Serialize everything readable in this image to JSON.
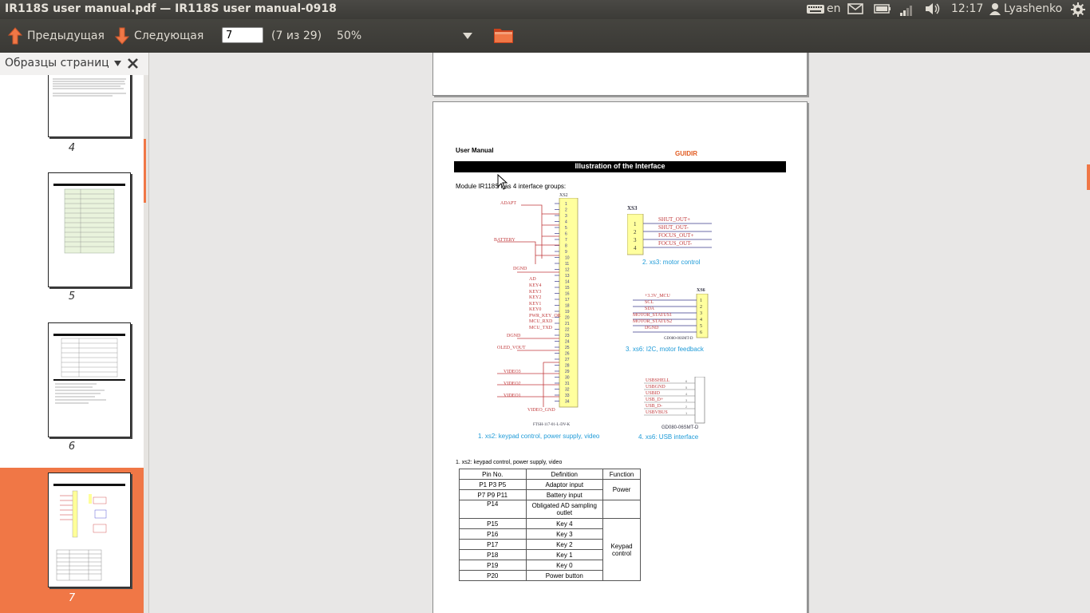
{
  "window_title": "IR118S user manual.pdf — IR118S user manual-0918",
  "panel": {
    "keyboard_layout": "en",
    "clock": "12:17",
    "user": "Lyashenko"
  },
  "toolbar": {
    "prev_label": "Предыдущая",
    "next_label": "Следующая",
    "page_value": "7",
    "page_count_label": "(7 из 29)",
    "zoom": "50%"
  },
  "sidebar": {
    "title": "Образцы страниц",
    "thumbnails": [
      {
        "label": "4"
      },
      {
        "label": "5"
      },
      {
        "label": "6"
      },
      {
        "label": "7",
        "selected": true
      }
    ]
  },
  "document": {
    "header_left": "User Manual",
    "logo": "GUIDIR",
    "section_title": "Illustration of the Interface",
    "intro": "Module IR118S has 4 interface groups:",
    "xs2": {
      "connector": "XS2",
      "left_labels": [
        "ADAPT",
        "BATTERY",
        "DGND",
        "AD",
        "KEY4",
        "KEY3",
        "KEY2",
        "KEY1",
        "KEY0",
        "PWR_KEY_OR",
        "MCU_RXD",
        "MCU_TXD",
        "DGND",
        "OLED_VOUT",
        "VIDEO3",
        "VIDEO2",
        "VIDEO1",
        "VIDEO_GND"
      ],
      "part": "FTSH-117-01-L-DV-K",
      "caption": "1. xs2: keypad control, power supply, video"
    },
    "xs3": {
      "connector": "XS3",
      "signals": [
        "SHUT_OUT+",
        "SHUT_OUT-",
        "FOCUS_OUT+",
        "FOCUS_OUT-"
      ],
      "caption": "2. xs3: motor control"
    },
    "xs6": {
      "connector": "XS6",
      "signals": [
        "+3.3V_MCU",
        "SCL",
        "SDA",
        "MOTOR_STATUS1",
        "MOTOR_STATUS2",
        "DGND"
      ],
      "part": "GD080-06SMT-D",
      "caption": "3. xs6: I2C, motor feedback"
    },
    "usb": {
      "signals": [
        "USBSHELL",
        "USBGND",
        "USBID",
        "USB_D+",
        "USB_D-",
        "USBVBUS"
      ],
      "part": "GD080-06SMT-D",
      "caption": "4. xs6: USB interface"
    },
    "table_caption": "1. xs2: keypad control, power supply, video",
    "table": {
      "headers": [
        "Pin No.",
        "Definition",
        "Function"
      ],
      "rows": [
        [
          "P1 P3 P5",
          "Adaptor input",
          "Power"
        ],
        [
          "P7 P9 P11",
          "Battery input",
          ""
        ],
        [
          "P14",
          "Obligated AD sampling outlet",
          ""
        ],
        [
          "P15",
          "Key 4",
          "Keypad control"
        ],
        [
          "P16",
          "Key 3",
          ""
        ],
        [
          "P17",
          "Key 2",
          ""
        ],
        [
          "P18",
          "Key 1",
          ""
        ],
        [
          "P19",
          "Key 0",
          ""
        ],
        [
          "P20",
          "Power button",
          ""
        ]
      ]
    }
  }
}
